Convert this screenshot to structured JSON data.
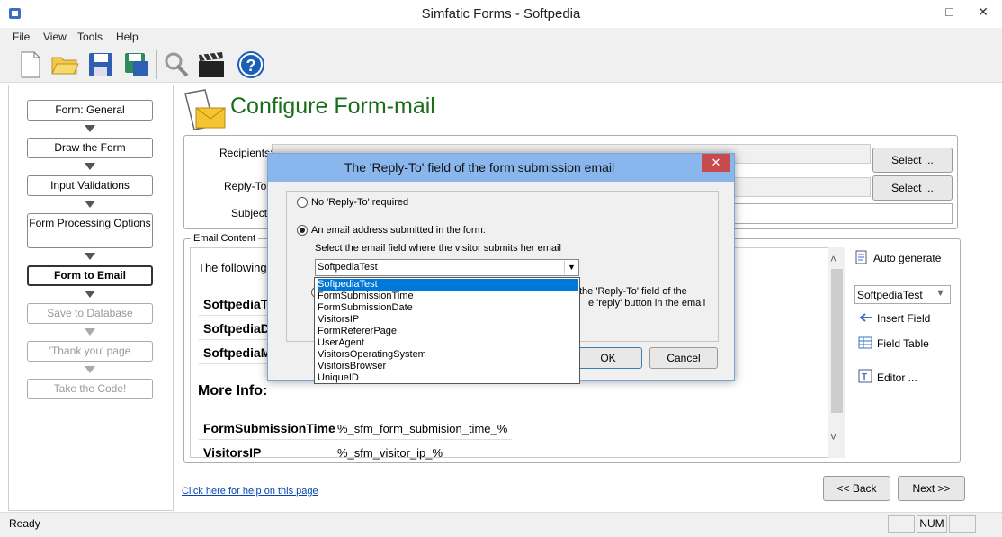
{
  "window": {
    "title": "Simfatic Forms - Softpedia"
  },
  "menu": [
    "File",
    "View",
    "Tools",
    "Help"
  ],
  "toolbar": [
    "new-doc-icon",
    "open-folder-icon",
    "save-icon",
    "save-as-icon",
    "settings-icon",
    "clapper-icon",
    "help-icon"
  ],
  "steps": [
    {
      "label": "Form: General",
      "state": "normal"
    },
    {
      "label": "Draw the Form",
      "state": "normal"
    },
    {
      "label": "Input Validations",
      "state": "normal"
    },
    {
      "label": "Form Processing Options",
      "state": "normal"
    },
    {
      "label": "Form to Email",
      "state": "active"
    },
    {
      "label": "Save to Database",
      "state": "disabled"
    },
    {
      "label": "'Thank you' page",
      "state": "disabled"
    },
    {
      "label": "Take the Code!",
      "state": "disabled"
    }
  ],
  "page": {
    "title": "Configure Form-mail",
    "recipients_label": "Recipients:",
    "replyto_label": "Reply-To:",
    "subject_label": "Subject:",
    "select_label_1": "Select ...",
    "select_label_2": "Select ...",
    "email_content_label": "Email Content",
    "intro_text": "The following",
    "rows_top": [
      "SoftpediaTe",
      "SoftpediaDr",
      "SoftpediaM"
    ],
    "more_info": "More Info:",
    "rows_bottom": [
      {
        "name": "FormSubmissionTime",
        "value": "%_sfm_form_submision_time_%"
      },
      {
        "name": "VisitorsIP",
        "value": "%_sfm_visitor_ip_%"
      }
    ],
    "auto_generate": "Auto generate",
    "field_select": "SoftpediaTest",
    "insert_field": "Insert Field",
    "field_table": "Field Table",
    "editor": "Editor ...",
    "help_link": "Click here for help on this page",
    "back_btn": "<< Back",
    "next_btn": "Next >>"
  },
  "dialog": {
    "title": "The 'Reply-To' field of the form submission email",
    "option_none": "No 'Reply-To' required",
    "option_email": "An email address submitted in the form:",
    "select_hint": "Select the email field where the visitor submits her email",
    "combo_value": "SoftpediaTest",
    "side_text_1": "the 'Reply-To' field of the",
    "side_text_2": "e 'reply' button in the email",
    "ok": "OK",
    "cancel": "Cancel",
    "options": [
      "SoftpediaTest",
      "FormSubmissionTime",
      "FormSubmissionDate",
      "VisitorsIP",
      "FormRefererPage",
      "UserAgent",
      "VisitorsOperatingSystem",
      "VisitorsBrowser",
      "UniqueID"
    ],
    "selected_index": 0
  },
  "status": {
    "left": "Ready",
    "num": "NUM"
  }
}
